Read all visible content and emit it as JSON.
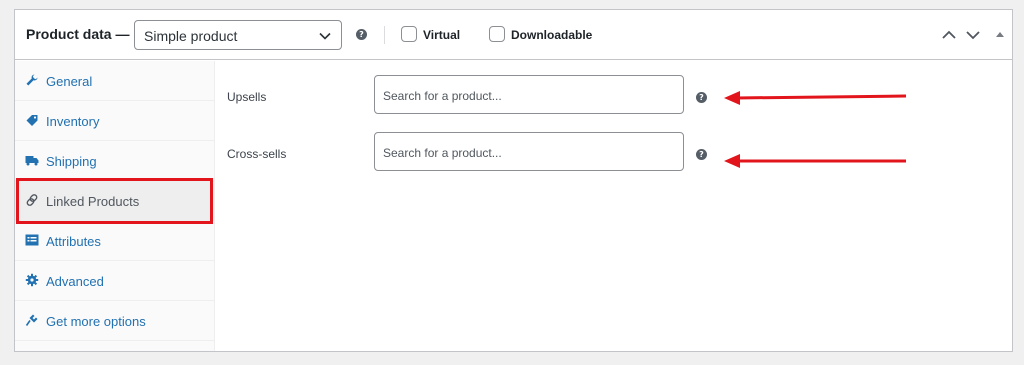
{
  "header": {
    "title": "Product data —",
    "product_type": "Simple product",
    "virtual_label": "Virtual",
    "downloadable_label": "Downloadable"
  },
  "sidebar": {
    "items": [
      {
        "label": "General",
        "icon": "wrench-icon"
      },
      {
        "label": "Inventory",
        "icon": "tag-icon"
      },
      {
        "label": "Shipping",
        "icon": "truck-icon"
      },
      {
        "label": "Linked Products",
        "icon": "link-icon",
        "active": true
      },
      {
        "label": "Attributes",
        "icon": "list-icon"
      },
      {
        "label": "Advanced",
        "icon": "gear-icon"
      },
      {
        "label": "Get more options",
        "icon": "plugin-icon"
      }
    ]
  },
  "fields": {
    "upsells": {
      "label": "Upsells",
      "placeholder": "Search for a product..."
    },
    "cross_sells": {
      "label": "Cross-sells",
      "placeholder": "Search for a product..."
    }
  },
  "colors": {
    "accent": "#2271b1",
    "annotation": "#e3151c"
  }
}
